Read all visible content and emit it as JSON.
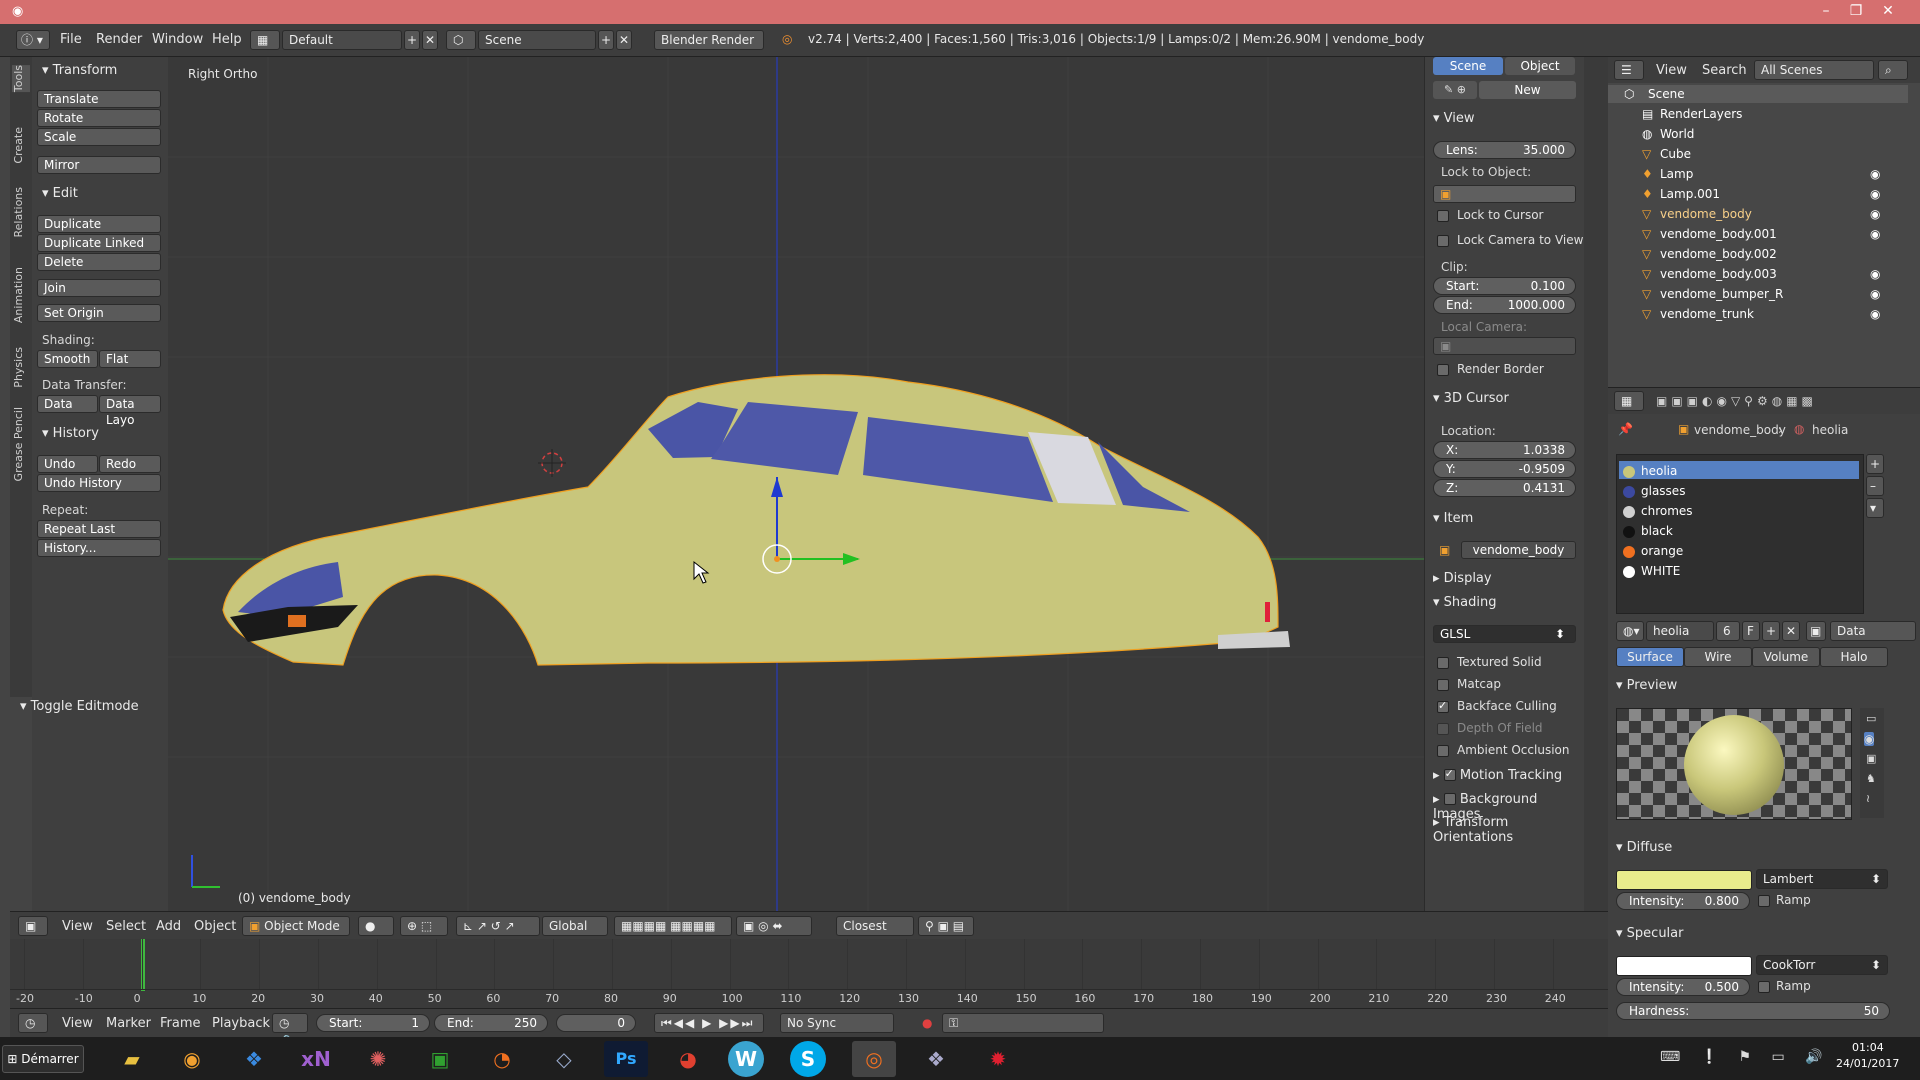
{
  "menus": {
    "file": "File",
    "render": "Render",
    "window": "Window",
    "help": "Help"
  },
  "header": {
    "layout": "Default",
    "scene": "Scene",
    "engine": "Blender Render",
    "stats": "v2.74 | Verts:2,400 | Faces:1,560 | Tris:3,016 | Objects:1/9 | Lamps:0/2 | Mem:26.90M | vendome_body"
  },
  "tabs": [
    "Tools",
    "Create",
    "Relations",
    "Animation",
    "Physics",
    "Grease Pencil"
  ],
  "toolshelf": {
    "transform": "Transform",
    "translate": "Translate",
    "rotate": "Rotate",
    "scale": "Scale",
    "mirror": "Mirror",
    "edit": "Edit",
    "duplicate": "Duplicate",
    "duplicate_linked": "Duplicate Linked",
    "delete": "Delete",
    "join": "Join",
    "set_origin": "Set Origin",
    "shading": "Shading:",
    "smooth": "Smooth",
    "flat": "Flat",
    "data_transfer": "Data Transfer:",
    "data": "Data",
    "data_layo": "Data Layo",
    "history": "History",
    "undo": "Undo",
    "redo": "Redo",
    "undo_history": "Undo History",
    "repeat": "Repeat:",
    "repeat_last": "Repeat Last",
    "history_dots": "History...",
    "toggle_editmode": "Toggle Editmode"
  },
  "viewport": {
    "label": "Right Ortho",
    "object": "(0) vendome_body",
    "body_color": "#c8c67c",
    "window_color": "#4e58a8"
  },
  "npanel": {
    "tab_scene": "Scene",
    "tab_object": "Object",
    "new": "New",
    "view": "View",
    "lens_l": "Lens:",
    "lens": "35.000",
    "lock_to_object": "Lock to Object:",
    "lock_to_cursor": "Lock to Cursor",
    "lock_camera": "Lock Camera to View",
    "clip": "Clip:",
    "start_l": "Start:",
    "start": "0.100",
    "end_l": "End:",
    "end": "1000.000",
    "local_camera": "Local Camera:",
    "render_border": "Render Border",
    "cursor": "3D Cursor",
    "location": "Location:",
    "x_l": "X:",
    "x": "1.0338",
    "y_l": "Y:",
    "y": "-0.9509",
    "z_l": "Z:",
    "z": "0.4131",
    "item": "Item",
    "item_name": "vendome_body",
    "display": "Display",
    "shading": "Shading",
    "glsl": "GLSL",
    "textured_solid": "Textured Solid",
    "matcap": "Matcap",
    "backface": "Backface Culling",
    "dof": "Depth Of Field",
    "ao": "Ambient Occlusion",
    "motion_tracking": "Motion Tracking",
    "background_images": "Background Images",
    "transform_orientations": "Transform Orientations"
  },
  "outliner": {
    "view": "View",
    "search": "Search",
    "all_scenes": "All Scenes",
    "items": [
      "Scene",
      "RenderLayers",
      "World",
      "Cube",
      "Lamp",
      "Lamp.001",
      "vendome_body",
      "vendome_body.001",
      "vendome_body.002",
      "vendome_body.003",
      "vendome_bumper_R",
      "vendome_trunk"
    ]
  },
  "props": {
    "crumb_obj": "vendome_body",
    "crumb_mat": "heolia",
    "materials": [
      {
        "name": "heolia",
        "color": "#c9c77a"
      },
      {
        "name": "glasses",
        "color": "#3c49a0"
      },
      {
        "name": "chromes",
        "color": "#d0d0d0"
      },
      {
        "name": "black",
        "color": "#111111"
      },
      {
        "name": "orange",
        "color": "#f07020"
      },
      {
        "name": "WHITE",
        "color": "#ffffff"
      }
    ],
    "mat_name": "heolia",
    "mat_users": "6",
    "f": "F",
    "data": "Data",
    "surface": "Surface",
    "wire": "Wire",
    "volume": "Volume",
    "halo": "Halo",
    "preview": "Preview",
    "diffuse": "Diffuse",
    "lambert": "Lambert",
    "intensity_l": "Intensity:",
    "d_intensity": "0.800",
    "ramp": "Ramp",
    "specular": "Specular",
    "cooktorr": "CookTorr",
    "s_intensity": "0.500",
    "hardness_l": "Hardness:",
    "hardness": "50",
    "diffuse_color": "#e8eb8c",
    "spec_color": "#ffffff"
  },
  "vpheader": {
    "view": "View",
    "select": "Select",
    "add": "Add",
    "object": "Object",
    "mode": "Object Mode",
    "global": "Global",
    "closest": "Closest"
  },
  "timeline": {
    "ticks": [
      "-20",
      "-10",
      "0",
      "10",
      "20",
      "30",
      "40",
      "50",
      "60",
      "70",
      "80",
      "90",
      "100",
      "110",
      "120",
      "130",
      "140",
      "150",
      "160",
      "170",
      "180",
      "190",
      "200",
      "210",
      "220",
      "230",
      "240"
    ],
    "view": "View",
    "marker": "Marker",
    "frame": "Frame",
    "playback": "Playback",
    "start_l": "Start:",
    "start": "1",
    "end_l": "End:",
    "end": "250",
    "current": "0",
    "sync": "No Sync"
  },
  "taskbar": {
    "start": "Démarrer",
    "time": "01:04",
    "date": "24/01/2017"
  }
}
